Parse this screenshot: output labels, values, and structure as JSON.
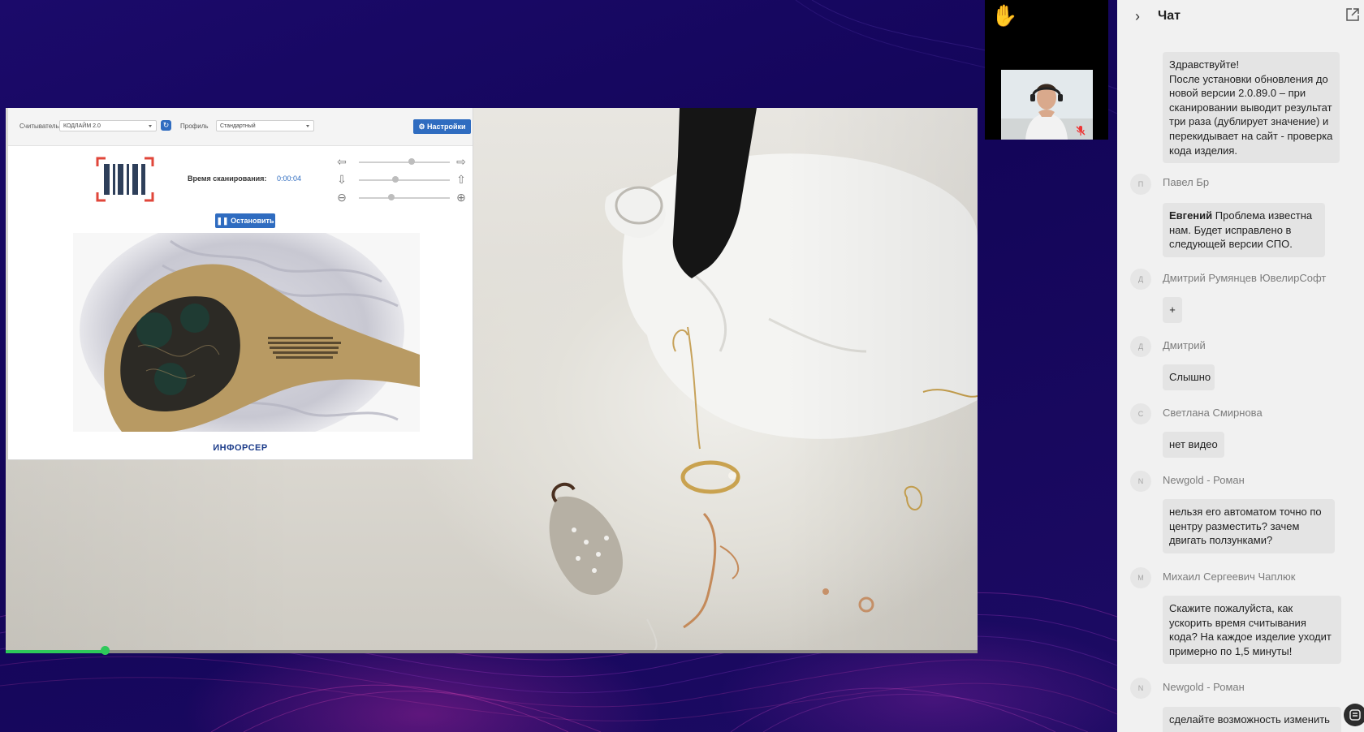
{
  "scanner": {
    "reader_label": "Считыватель",
    "reader_value": "КОДЛАЙМ 2.0",
    "profile_label": "Профиль",
    "profile_value": "Стандартный",
    "settings_label": "Настройки",
    "scan_time_label": "Время сканирования:",
    "scan_time_value": "0:00:04",
    "stop_label": "Остановить",
    "logo_text": "ИНФОРСЕР"
  },
  "video": {
    "progress": 0.102,
    "accent_color": "#2ec95a"
  },
  "chat": {
    "title": "Чат",
    "messages": [
      {
        "author": "",
        "avatar": "",
        "mention": "",
        "text": "Здравствуйте!\nПосле установки обновления до новой версии  2.0.89.0 – при сканировании выводит результат три раза (дублирует значение) и перекидывает на сайт - проверка кода изделия."
      },
      {
        "author": "Павел Бр",
        "avatar": "П",
        "mention": "Евгений",
        "text": " Проблема известна нам. Будет исправлено в следующей версии СПО."
      },
      {
        "author": "Дмитрий Румянцев ЮвелирСофт",
        "avatar": "Д",
        "mention": "",
        "text": "+"
      },
      {
        "author": "Дмитрий",
        "avatar": "Д",
        "mention": "",
        "text": "Слышно"
      },
      {
        "author": "Светлана Смирнова",
        "avatar": "С",
        "mention": "",
        "text": "нет видео"
      },
      {
        "author": "Newgold - Роман",
        "avatar": "N",
        "mention": "",
        "text": "нельзя его автоматом точно по центру разместить? зачем двигать ползунками?"
      },
      {
        "author": "Михаил Сергеевич Чаплюк",
        "avatar": "М",
        "mention": "",
        "text": "Скажите пожалуйста, как ускорить время считывания кода? На каждое изделие уходит примерно по 1,5 минуты!"
      },
      {
        "author": "Newgold - Роман",
        "avatar": "N",
        "mention": "",
        "text": "сделайте возможность изменить размер окна, слева не"
      }
    ]
  }
}
